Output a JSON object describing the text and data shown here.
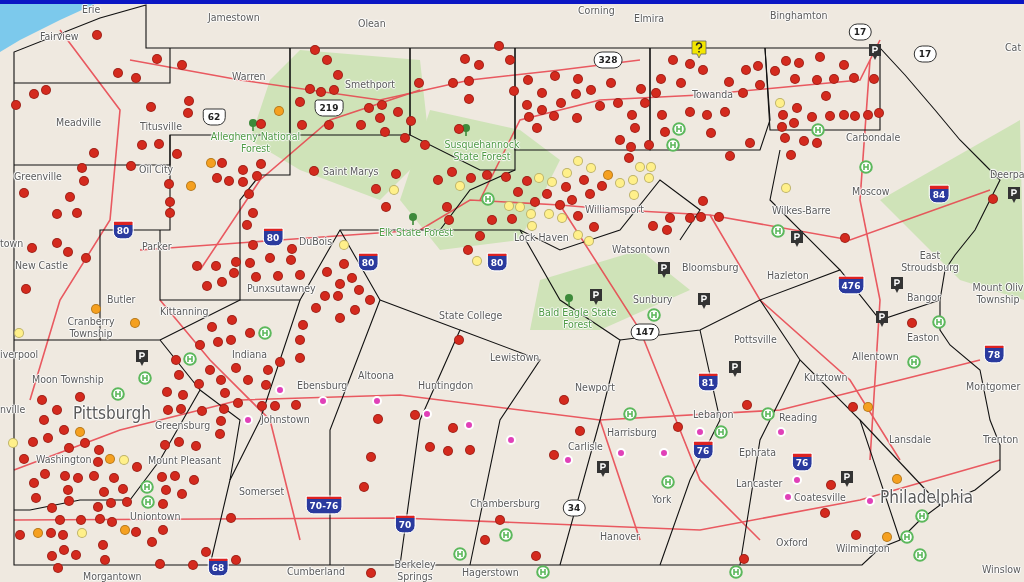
{
  "map": {
    "labels": [
      {
        "text": "Erie",
        "kind": "city"
      },
      {
        "text": "Jamestown",
        "kind": "city"
      },
      {
        "text": "Corning",
        "kind": "city"
      },
      {
        "text": "Olean",
        "kind": "city"
      },
      {
        "text": "Elmira",
        "kind": "city"
      },
      {
        "text": "Binghamton",
        "kind": "city"
      },
      {
        "text": "Fairview",
        "kind": "city"
      },
      {
        "text": "Cat",
        "kind": "city"
      },
      {
        "text": "Warren",
        "kind": "city"
      },
      {
        "text": "Smethport",
        "kind": "city"
      },
      {
        "text": "Towanda",
        "kind": "city"
      },
      {
        "text": "Meadville",
        "kind": "city"
      },
      {
        "text": "Titusville",
        "kind": "city"
      },
      {
        "text": "Allegheny National Forest",
        "kind": "forest"
      },
      {
        "text": "Susquehannock State Forest",
        "kind": "forest"
      },
      {
        "text": "Carbondale",
        "kind": "city"
      },
      {
        "text": "Greenville",
        "kind": "city"
      },
      {
        "text": "Oil City",
        "kind": "city"
      },
      {
        "text": "Saint Marys",
        "kind": "city"
      },
      {
        "text": "Deerpa",
        "kind": "city"
      },
      {
        "text": "Moscow",
        "kind": "city"
      },
      {
        "text": "Williamsport",
        "kind": "city"
      },
      {
        "text": "Wilkes-Barre",
        "kind": "city"
      },
      {
        "text": "town",
        "kind": "city"
      },
      {
        "text": "Parker",
        "kind": "city"
      },
      {
        "text": "DuBois",
        "kind": "city"
      },
      {
        "text": "Elk State Forest",
        "kind": "forest"
      },
      {
        "text": "Lock Haven",
        "kind": "city"
      },
      {
        "text": "Watsontown",
        "kind": "city"
      },
      {
        "text": "New Castle",
        "kind": "city"
      },
      {
        "text": "Bloomsburg",
        "kind": "city"
      },
      {
        "text": "Hazleton",
        "kind": "city"
      },
      {
        "text": "East Stroudsburg",
        "kind": "city"
      },
      {
        "text": "Butler",
        "kind": "city"
      },
      {
        "text": "Punxsutawney",
        "kind": "city"
      },
      {
        "text": "Sunbury",
        "kind": "city"
      },
      {
        "text": "Bangor",
        "kind": "city"
      },
      {
        "text": "Mount Oliv Township",
        "kind": "city"
      },
      {
        "text": "Cranberry Township",
        "kind": "city"
      },
      {
        "text": "Kittanning",
        "kind": "city"
      },
      {
        "text": "State College",
        "kind": "city"
      },
      {
        "text": "Bald Eagle State Forest",
        "kind": "forest"
      },
      {
        "text": "Pottsville",
        "kind": "city"
      },
      {
        "text": "Easton",
        "kind": "city"
      },
      {
        "text": "iverpool",
        "kind": "city"
      },
      {
        "text": "Indiana",
        "kind": "city"
      },
      {
        "text": "Lewistown",
        "kind": "city"
      },
      {
        "text": "Allentown",
        "kind": "city"
      },
      {
        "text": "Moon Township",
        "kind": "city"
      },
      {
        "text": "Ebensburg",
        "kind": "city"
      },
      {
        "text": "Altoona",
        "kind": "city"
      },
      {
        "text": "Huntingdon",
        "kind": "city"
      },
      {
        "text": "Newport",
        "kind": "city"
      },
      {
        "text": "Kutztown",
        "kind": "city"
      },
      {
        "text": "Montgomer",
        "kind": "city"
      },
      {
        "text": "nville",
        "kind": "city"
      },
      {
        "text": "Pittsburgh",
        "kind": "major"
      },
      {
        "text": "Greensburg",
        "kind": "city"
      },
      {
        "text": "Johnstown",
        "kind": "city"
      },
      {
        "text": "Lebanon",
        "kind": "city"
      },
      {
        "text": "Reading",
        "kind": "city"
      },
      {
        "text": "Harrisburg",
        "kind": "city"
      },
      {
        "text": "Carlisle",
        "kind": "city"
      },
      {
        "text": "Lansdale",
        "kind": "city"
      },
      {
        "text": "Trenton",
        "kind": "city"
      },
      {
        "text": "Washington",
        "kind": "city"
      },
      {
        "text": "Mount Pleasant",
        "kind": "city"
      },
      {
        "text": "Ephrata",
        "kind": "city"
      },
      {
        "text": "Somerset",
        "kind": "city"
      },
      {
        "text": "Lancaster",
        "kind": "city"
      },
      {
        "text": "Chambersburg",
        "kind": "city"
      },
      {
        "text": "York",
        "kind": "city"
      },
      {
        "text": "Coatesville",
        "kind": "city"
      },
      {
        "text": "Philadelphia",
        "kind": "major"
      },
      {
        "text": "Uniontown",
        "kind": "city"
      },
      {
        "text": "Hanover",
        "kind": "city"
      },
      {
        "text": "Oxford",
        "kind": "city"
      },
      {
        "text": "Wilmington",
        "kind": "city"
      },
      {
        "text": "Morgantown",
        "kind": "city"
      },
      {
        "text": "Cumberland",
        "kind": "city"
      },
      {
        "text": "Berkeley Springs",
        "kind": "city"
      },
      {
        "text": "Hagerstown",
        "kind": "city"
      },
      {
        "text": "Winslow",
        "kind": "city"
      }
    ],
    "shields": [
      {
        "text": "62",
        "kind": "us"
      },
      {
        "text": "219",
        "kind": "us"
      },
      {
        "text": "328",
        "kind": "state"
      },
      {
        "text": "17",
        "kind": "state"
      },
      {
        "text": "17",
        "kind": "state"
      },
      {
        "text": "80",
        "kind": "interstate"
      },
      {
        "text": "80",
        "kind": "interstate"
      },
      {
        "text": "80",
        "kind": "interstate"
      },
      {
        "text": "80",
        "kind": "interstate"
      },
      {
        "text": "84",
        "kind": "interstate"
      },
      {
        "text": "476",
        "kind": "interstate"
      },
      {
        "text": "147",
        "kind": "state"
      },
      {
        "text": "78",
        "kind": "interstate"
      },
      {
        "text": "81",
        "kind": "interstate"
      },
      {
        "text": "76",
        "kind": "interstate"
      },
      {
        "text": "76",
        "kind": "interstate"
      },
      {
        "text": "70-76",
        "kind": "interstate"
      },
      {
        "text": "70",
        "kind": "interstate"
      },
      {
        "text": "68",
        "kind": "interstate"
      },
      {
        "text": "34",
        "kind": "state"
      }
    ],
    "marker_layers": [
      {
        "kind": "dot",
        "color": "#d42a1e"
      },
      {
        "kind": "dot",
        "color": "#fff08a"
      },
      {
        "kind": "dot",
        "color": "#f5a020"
      },
      {
        "kind": "dot",
        "color": "#e040b8"
      },
      {
        "kind": "hospital",
        "color": "#5cb85c"
      },
      {
        "kind": "parking",
        "color": "#333333"
      },
      {
        "kind": "question",
        "color": "#f2e600"
      }
    ]
  }
}
